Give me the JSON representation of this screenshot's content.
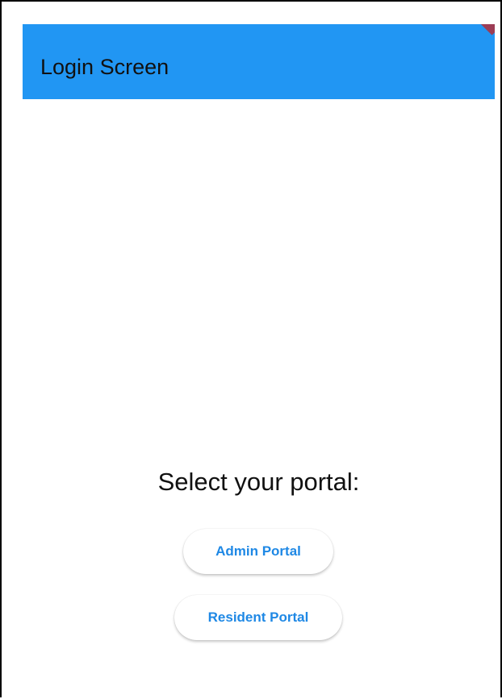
{
  "appbar": {
    "title": "Login Screen",
    "color": "#2196F3"
  },
  "main": {
    "heading": "Select your portal:",
    "buttons": {
      "admin_label": "Admin Portal",
      "resident_label": "Resident Portal"
    }
  },
  "colors": {
    "accent": "#1E88E5",
    "background": "#FFFFFF"
  }
}
